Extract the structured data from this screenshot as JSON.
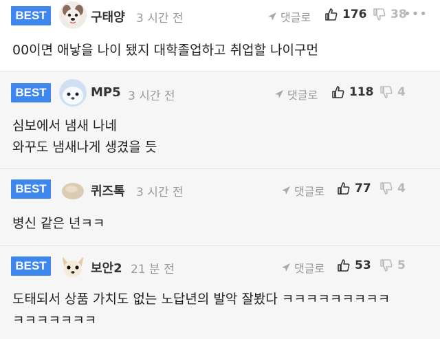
{
  "comments": [
    {
      "badge": "BEST",
      "nickname": "구태양",
      "time": "3 시간 전",
      "reply_label": "댓글로",
      "likes": "176",
      "dislikes": "38",
      "avatar_icon": "dog-face-avatar",
      "text": "00이면 애낳을 나이 됐지 대학졸업하고 취업할 나이구먼"
    },
    {
      "badge": "BEST",
      "nickname": "MP5",
      "time": "3 시간 전",
      "reply_label": "댓글로",
      "likes": "118",
      "dislikes": "4",
      "avatar_icon": "white-seal-avatar",
      "text": "심보에서 냄새 나네\n와꾸도 냄새나게 생겼을 듯"
    },
    {
      "badge": "BEST",
      "nickname": "퀴즈톡",
      "time": "3 시간 전",
      "reply_label": "댓글로",
      "likes": "77",
      "dislikes": "4",
      "avatar_icon": "rice-cake-avatar",
      "text": "병신 같은 년ㅋㅋ"
    },
    {
      "badge": "BEST",
      "nickname": "보안2",
      "time": "21 분 전",
      "reply_label": "댓글로",
      "likes": "53",
      "dislikes": "5",
      "avatar_icon": "chihuahua-avatar",
      "text": "도태되서 상품 가치도 없는 노답년의 발악 잘봤다 ㅋㅋㅋㅋㅋㅋㅋㅋㅋ\nㅋㅋㅋㅋㅋㅋㅋ"
    }
  ],
  "colors": {
    "badge_bg": "#3d87ef",
    "row_bg_alt": "#f6f6f6",
    "muted": "#9a9a9a"
  }
}
